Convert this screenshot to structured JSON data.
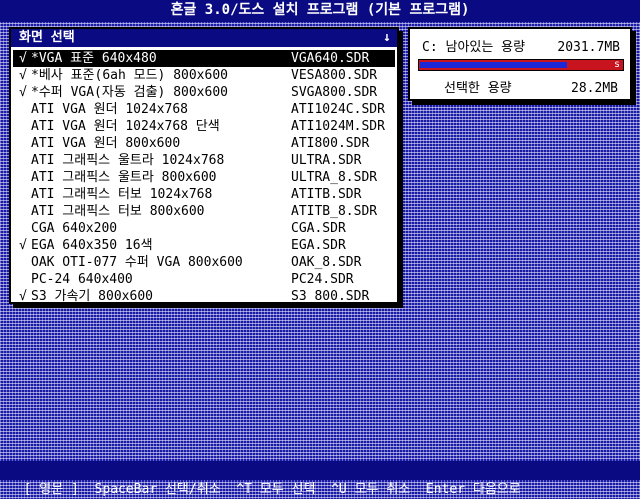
{
  "title": "혼글 3.0/도스 설치 프로그램 (기본 프로그램)",
  "panel": {
    "title": "화면 선택",
    "arrow": "↓",
    "rows": [
      {
        "check": "√",
        "label": "*VGA 표준 640x480",
        "file": "VGA640.SDR",
        "selected": true
      },
      {
        "check": "√",
        "label": "*베사 표준(6ah 모드) 800x600",
        "file": "VESA800.SDR",
        "selected": false
      },
      {
        "check": "√",
        "label": "*수퍼 VGA(자동 검출) 800x600",
        "file": "SVGA800.SDR",
        "selected": false
      },
      {
        "check": "",
        "label": "ATI VGA 원더 1024x768",
        "file": "ATI1024C.SDR",
        "selected": false
      },
      {
        "check": "",
        "label": "ATI VGA 원더 1024x768 단색",
        "file": "ATI1024M.SDR",
        "selected": false
      },
      {
        "check": "",
        "label": "ATI VGA 원더 800x600",
        "file": "ATI800.SDR",
        "selected": false
      },
      {
        "check": "",
        "label": "ATI 그래픽스 울트라 1024x768",
        "file": "ULTRA.SDR",
        "selected": false
      },
      {
        "check": "",
        "label": "ATI 그래픽스 울트라 800x600",
        "file": "ULTRA_8.SDR",
        "selected": false
      },
      {
        "check": "",
        "label": "ATI 그래픽스 터보 1024x768",
        "file": "ATITB.SDR",
        "selected": false
      },
      {
        "check": "",
        "label": "ATI 그래픽스 터보 800x600",
        "file": "ATITB_8.SDR",
        "selected": false
      },
      {
        "check": "",
        "label": "CGA 640x200",
        "file": "CGA.SDR",
        "selected": false
      },
      {
        "check": "√",
        "label": "EGA 640x350 16색",
        "file": "EGA.SDR",
        "selected": false
      },
      {
        "check": "",
        "label": "OAK OTI-077 수퍼 VGA 800x600",
        "file": "OAK_8.SDR",
        "selected": false
      },
      {
        "check": "",
        "label": "PC-24 640x400",
        "file": "PC24.SDR",
        "selected": false
      },
      {
        "check": "√",
        "label": "S3 가속기 800x600",
        "file": "S3_800.SDR",
        "selected": false
      }
    ]
  },
  "disk": {
    "free_label": "C: 남아있는 용량",
    "free_value": "2031.7MB",
    "selected_label": "선택한 용량",
    "selected_value": "28.2MB",
    "used_fraction": 0.72,
    "mark": "s",
    "colors": {
      "used": "#1c28d8",
      "free": "#c8141e"
    }
  },
  "footer": "[ 영문 ]  SpaceBar 선택/취소  ^T 모두 선택  ^U 모두 취소  Enter 다음으로"
}
